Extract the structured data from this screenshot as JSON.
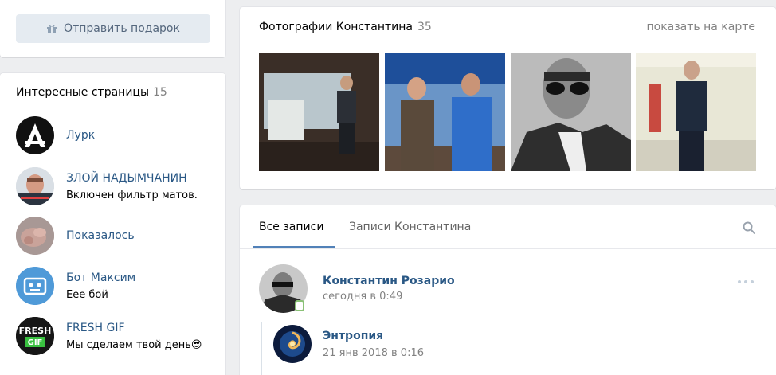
{
  "left": {
    "gift_button": {
      "label": "Отправить подарок",
      "icon": "gift-icon"
    },
    "interesting": {
      "title": "Интересные страницы",
      "count": "15",
      "items": [
        {
          "name": "Лурк",
          "desc": "",
          "icon": "lurk-logo"
        },
        {
          "name": "ЗЛОЙ НАДЫМЧАНИН",
          "desc": "Включен фильтр матов.",
          "icon": "community-avatar"
        },
        {
          "name": "Показалось",
          "desc": "",
          "icon": "community-avatar"
        },
        {
          "name": "Бот Максим",
          "desc": "Еее бой",
          "icon": "robot-avatar"
        },
        {
          "name": "FRESH GIF",
          "desc": "Мы сделаем твой день😎",
          "icon": "fresh-gif-logo"
        }
      ]
    }
  },
  "photos": {
    "title": "Фотографии Константина",
    "count": "35",
    "map_link": "показать на карте"
  },
  "wall": {
    "tabs": [
      "Все записи",
      "Записи Константина"
    ],
    "active_tab": 0,
    "post": {
      "author": "Константин Розарио",
      "date": "сегодня в 0:49",
      "repost": {
        "author": "Энтропия",
        "date": "21 янв 2018 в 0:16"
      }
    }
  },
  "colors": {
    "link": "#2a5885",
    "accent": "#5181b8",
    "muted": "#828282",
    "background": "#edeef0"
  }
}
